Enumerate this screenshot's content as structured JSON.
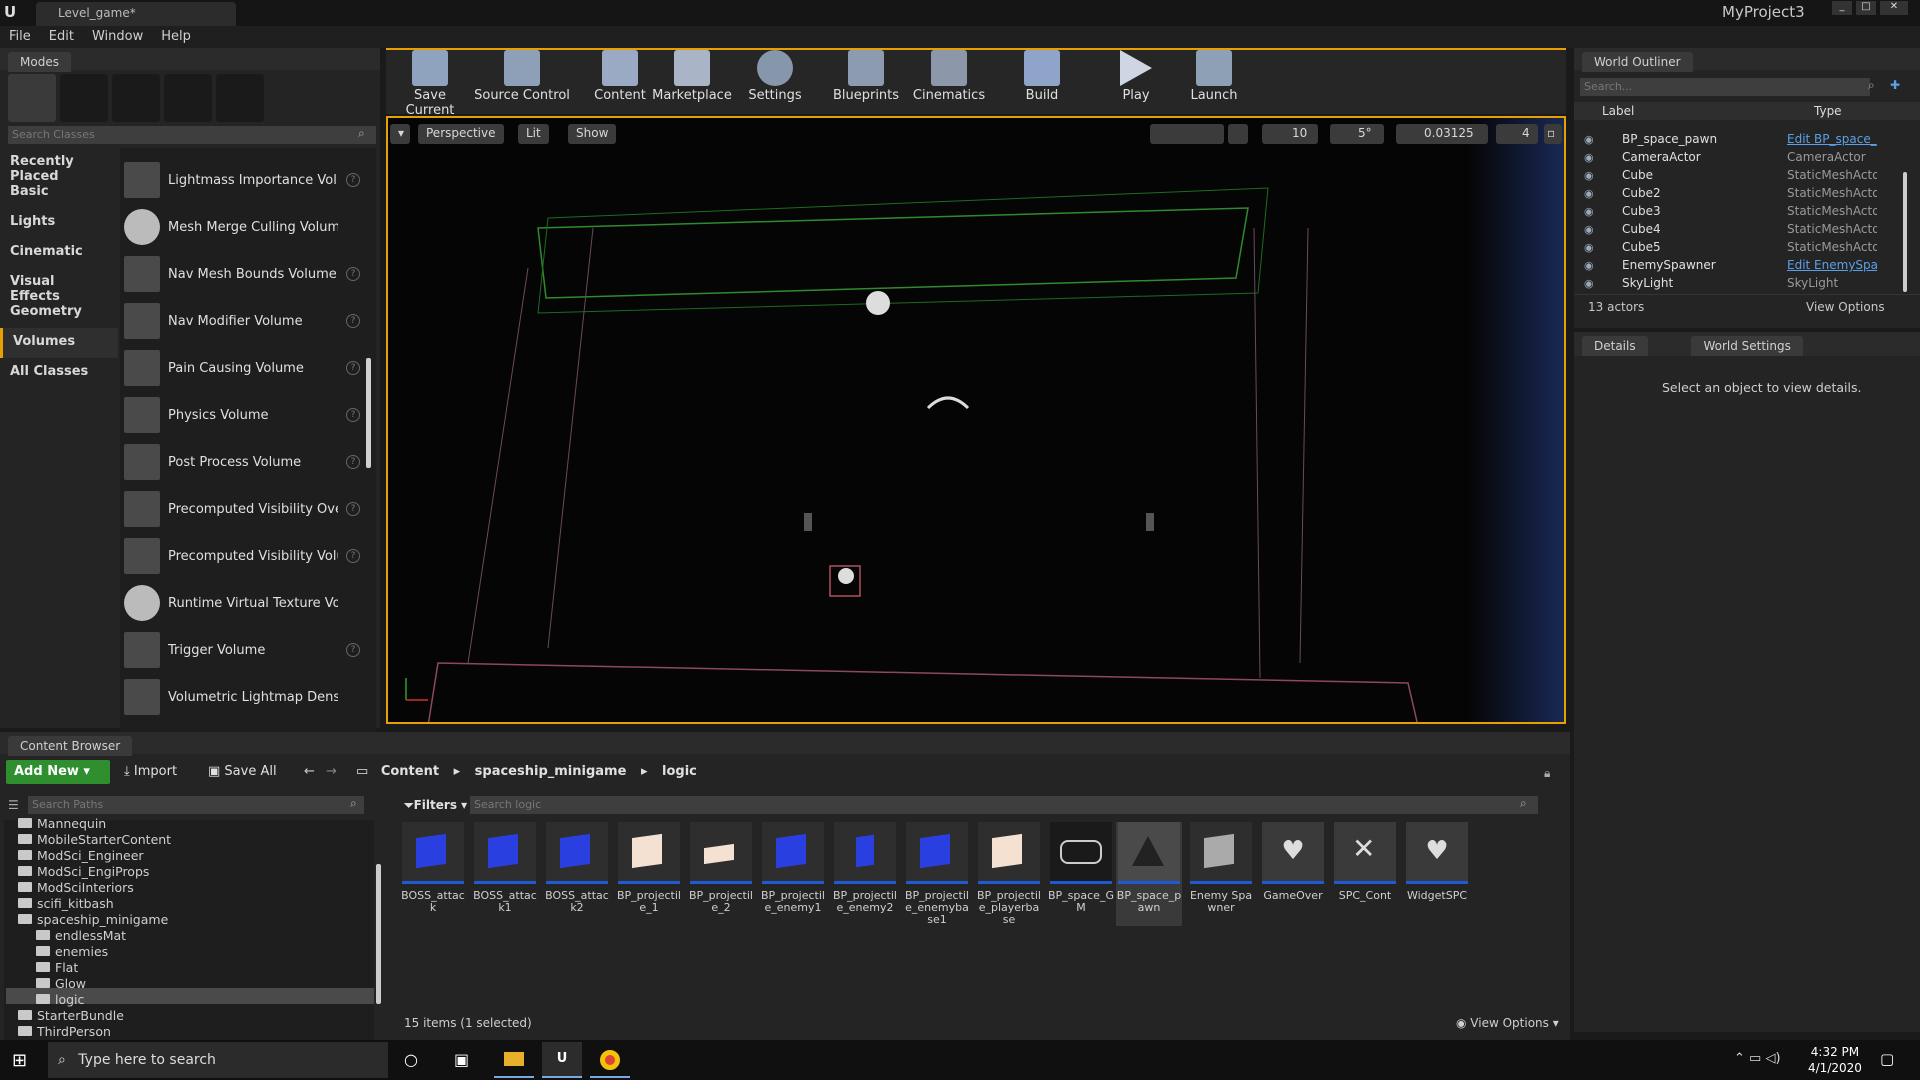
{
  "title_bar": {
    "tab_label": "Level_game*",
    "project_name": "MyProject3"
  },
  "menu": [
    "File",
    "Edit",
    "Window",
    "Help"
  ],
  "modes_panel": {
    "title": "Modes",
    "search_placeholder": "Search Classes",
    "categories": [
      "Recently Placed",
      "Basic",
      "Lights",
      "Cinematic",
      "Visual Effects",
      "Geometry",
      "Volumes",
      "All Classes"
    ],
    "selected_category": "Volumes",
    "items": [
      "Lightmass Importance Volum",
      "Mesh Merge Culling Volume",
      "Nav Mesh Bounds Volume",
      "Nav Modifier Volume",
      "Pain Causing Volume",
      "Physics Volume",
      "Post Process Volume",
      "Precomputed Visibility Overri",
      "Precomputed Visibility Volum",
      "Runtime Virtual Texture Volume",
      "Trigger Volume",
      "Volumetric Lightmap Density Vol"
    ],
    "help_glyph": "?"
  },
  "toolbar": {
    "buttons": [
      "Save Current",
      "Source Control",
      "Content",
      "Marketplace",
      "Settings",
      "Blueprints",
      "Cinematics",
      "Build",
      "Play",
      "Launch"
    ]
  },
  "viewport": {
    "perspective": "Perspective",
    "lit": "Lit",
    "show": "Show",
    "grid_snap": "10",
    "rot_snap": "5°",
    "scale_snap": "0.03125",
    "cam_speed": "4"
  },
  "world_outliner": {
    "title": "World Outliner",
    "search_placeholder": "Search...",
    "col_label": "Label",
    "col_type": "Type",
    "rows": [
      {
        "name": "BP_space_pawn",
        "type": "Edit BP_space_",
        "link": true
      },
      {
        "name": "CameraActor",
        "type": "CameraActor",
        "link": false
      },
      {
        "name": "Cube",
        "type": "StaticMeshActo",
        "link": false
      },
      {
        "name": "Cube2",
        "type": "StaticMeshActo",
        "link": false
      },
      {
        "name": "Cube3",
        "type": "StaticMeshActo",
        "link": false
      },
      {
        "name": "Cube4",
        "type": "StaticMeshActo",
        "link": false
      },
      {
        "name": "Cube5",
        "type": "StaticMeshActo",
        "link": false
      },
      {
        "name": "EnemySpawner",
        "type": "Edit EnemySpa",
        "link": true
      },
      {
        "name": "SkyLight",
        "type": "SkyLight",
        "link": false
      }
    ],
    "count": "13 actors",
    "view_options": "View Options"
  },
  "details": {
    "tab_details": "Details",
    "tab_world_settings": "World Settings",
    "empty_text": "Select an object to view details."
  },
  "content_browser": {
    "title": "Content Browser",
    "add_new": "Add New",
    "import": "Import",
    "save_all": "Save All",
    "breadcrumb": [
      "Content",
      "spaceship_minigame",
      "logic"
    ],
    "search_paths_placeholder": "Search Paths",
    "filters": "Filters",
    "search_placeholder": "Search logic",
    "tree": [
      {
        "label": "Mannequin",
        "level": 1
      },
      {
        "label": "MobileStarterContent",
        "level": 1
      },
      {
        "label": "ModSci_Engineer",
        "level": 1
      },
      {
        "label": "ModSci_EngiProps",
        "level": 1
      },
      {
        "label": "ModSciInteriors",
        "level": 1
      },
      {
        "label": "scifi_kitbash",
        "level": 1
      },
      {
        "label": "spaceship_minigame",
        "level": 1
      },
      {
        "label": "endlessMat",
        "level": 2
      },
      {
        "label": "enemies",
        "level": 2
      },
      {
        "label": "Flat",
        "level": 2
      },
      {
        "label": "Glow",
        "level": 2
      },
      {
        "label": "logic",
        "level": 2
      },
      {
        "label": "StarterBundle",
        "level": 1
      },
      {
        "label": "ThirdPerson",
        "level": 1
      }
    ],
    "assets": [
      "BOSS_attack",
      "BOSS_attack1",
      "BOSS_attack2",
      "BP_projectile_1",
      "BP_projectile_2",
      "BP_projectile_enemy1",
      "BP_projectile_enemy2",
      "BP_projectile_enemybase1",
      "BP_projectile_playerbase",
      "BP_space_GM",
      "BP_space_pawn",
      "Enemy Spawner",
      "GameOver",
      "SPC_Cont",
      "WidgetSPC"
    ],
    "status": "15 items (1 selected)",
    "view_options": "View Options"
  },
  "taskbar": {
    "search_placeholder": "Type here to search",
    "time": "4:32 PM",
    "date": "4/1/2020"
  }
}
